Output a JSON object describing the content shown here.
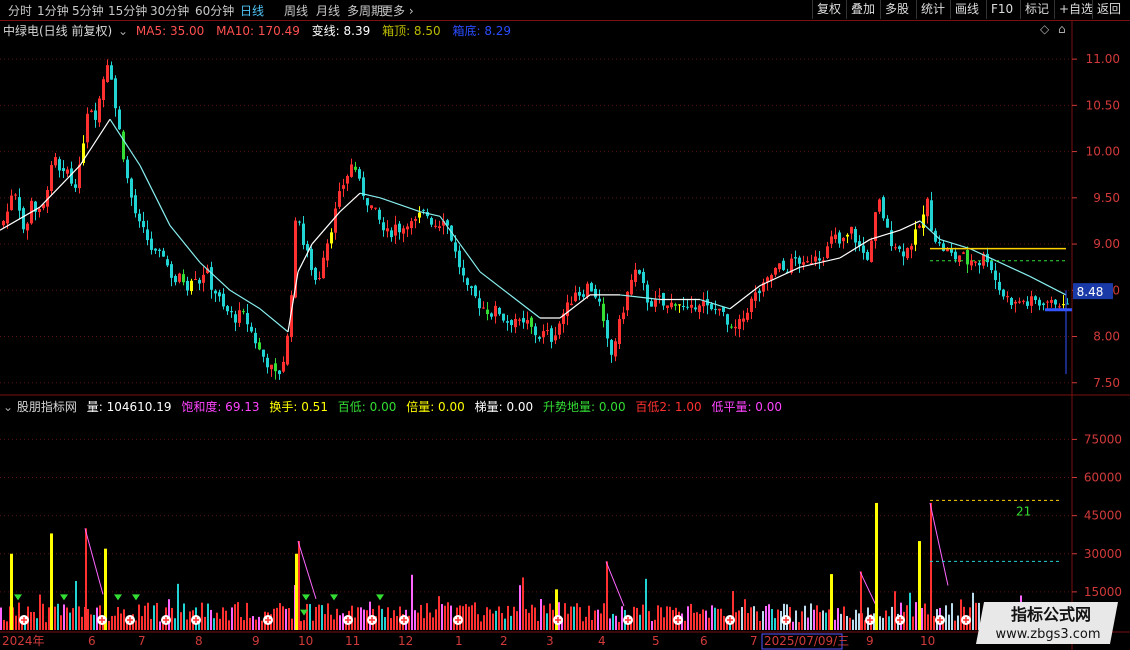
{
  "toolbar": {
    "timeframes": [
      "分时",
      "1分钟",
      "5分钟",
      "15分钟",
      "30分钟",
      "60分钟",
      "日线",
      "周线",
      "月线",
      "多周期",
      "更多"
    ],
    "active_timeframe": "日线",
    "buttons": [
      "复权",
      "叠加",
      "多股",
      "统计",
      "画线",
      "F10",
      "标记",
      "+自选",
      "返回"
    ]
  },
  "main": {
    "title": "中绿电(日线 前复权)",
    "ma5": "MA5: 35.00",
    "ma10": "MA10: 170.49",
    "var_line": "变线: 8.39",
    "box_top": "箱顶: 8.50",
    "box_bottom": "箱底: 8.29",
    "price_tag": "8.48"
  },
  "sub": {
    "title": "股朋指标网",
    "volume": "量: 104610.19",
    "saturation": "饱和度: 69.13",
    "turnover": "换手: 0.51",
    "hundred_low": "百低: 0.00",
    "multiple": "倍量: 0.00",
    "ladder": "梯量: 0.00",
    "rise_ground": "升势地量: 0.00",
    "hundred_low2": "百低2: 1.00",
    "low_flat": "低平量: 0.00",
    "marker_21": "21"
  },
  "colors": {
    "up": "#ff3030",
    "down": "#22d3d3",
    "yellow": "#ffff00",
    "green": "#33dd33",
    "magenta": "#ff44ff",
    "axis": "#d23a3a",
    "white": "#ffffff"
  },
  "chart_data": [
    {
      "type": "candlestick",
      "title": "中绿电(日线 前复权)",
      "y_ticks": [
        11.0,
        10.5,
        10.0,
        9.5,
        9.0,
        8.5,
        8.0,
        7.5
      ],
      "ylim": [
        7.4,
        11.25
      ],
      "x_ticks": [
        "2024年",
        "6",
        "7",
        "8",
        "9",
        "10",
        "11",
        "12",
        "1",
        "2",
        "3",
        "4",
        "5",
        "6",
        "7",
        "2025/07/09/三",
        "9",
        "10"
      ],
      "price_path": [
        [
          0,
          9.2
        ],
        [
          6,
          9.35
        ],
        [
          12,
          9.65
        ],
        [
          18,
          9.4
        ],
        [
          24,
          9.05
        ],
        [
          30,
          9.5
        ],
        [
          36,
          9.3
        ],
        [
          42,
          9.4
        ],
        [
          48,
          9.75
        ],
        [
          54,
          9.9
        ],
        [
          60,
          9.7
        ],
        [
          66,
          9.8
        ],
        [
          72,
          9.6
        ],
        [
          78,
          9.8
        ],
        [
          84,
          10.3
        ],
        [
          88,
          10.6
        ],
        [
          92,
          10.35
        ],
        [
          96,
          10.45
        ],
        [
          100,
          10.7
        ],
        [
          104,
          10.9
        ],
        [
          108,
          11.05
        ],
        [
          112,
          10.6
        ],
        [
          116,
          10.35
        ],
        [
          120,
          10.1
        ],
        [
          126,
          9.7
        ],
        [
          132,
          9.4
        ],
        [
          138,
          9.2
        ],
        [
          144,
          9.1
        ],
        [
          150,
          8.95
        ],
        [
          156,
          8.85
        ],
        [
          162,
          8.9
        ],
        [
          168,
          8.7
        ],
        [
          174,
          8.6
        ],
        [
          180,
          8.65
        ],
        [
          186,
          8.55
        ],
        [
          192,
          8.7
        ],
        [
          198,
          8.6
        ],
        [
          204,
          8.75
        ],
        [
          210,
          8.55
        ],
        [
          216,
          8.45
        ],
        [
          222,
          8.3
        ],
        [
          228,
          8.25
        ],
        [
          234,
          8.2
        ],
        [
          240,
          8.25
        ],
        [
          246,
          8.15
        ],
        [
          252,
          8.0
        ],
        [
          258,
          7.85
        ],
        [
          264,
          7.75
        ],
        [
          270,
          7.65
        ],
        [
          276,
          7.55
        ],
        [
          282,
          7.75
        ],
        [
          288,
          8.1
        ],
        [
          292,
          8.9
        ],
        [
          296,
          9.5
        ],
        [
          300,
          9.05
        ],
        [
          304,
          8.95
        ],
        [
          310,
          8.75
        ],
        [
          316,
          8.55
        ],
        [
          322,
          8.9
        ],
        [
          328,
          9.1
        ],
        [
          334,
          9.35
        ],
        [
          340,
          9.6
        ],
        [
          346,
          9.75
        ],
        [
          352,
          9.9
        ],
        [
          358,
          9.65
        ],
        [
          364,
          9.5
        ],
        [
          370,
          9.4
        ],
        [
          376,
          9.3
        ],
        [
          382,
          9.15
        ],
        [
          388,
          9.1
        ],
        [
          394,
          9.2
        ],
        [
          400,
          9.15
        ],
        [
          406,
          9.25
        ],
        [
          412,
          9.2
        ],
        [
          418,
          9.3
        ],
        [
          424,
          9.35
        ],
        [
          430,
          9.25
        ],
        [
          436,
          9.2
        ],
        [
          442,
          9.3
        ],
        [
          448,
          9.15
        ],
        [
          454,
          8.9
        ],
        [
          460,
          8.7
        ],
        [
          466,
          8.5
        ],
        [
          472,
          8.45
        ],
        [
          478,
          8.35
        ],
        [
          484,
          8.3
        ],
        [
          490,
          8.25
        ],
        [
          496,
          8.3
        ],
        [
          502,
          8.2
        ],
        [
          508,
          8.15
        ],
        [
          514,
          8.2
        ],
        [
          520,
          8.1
        ],
        [
          526,
          8.15
        ],
        [
          532,
          8.05
        ],
        [
          538,
          8.0
        ],
        [
          544,
          8.05
        ],
        [
          550,
          7.98
        ],
        [
          556,
          8.1
        ],
        [
          562,
          8.25
        ],
        [
          568,
          8.35
        ],
        [
          574,
          8.5
        ],
        [
          580,
          8.45
        ],
        [
          586,
          8.55
        ],
        [
          592,
          8.5
        ],
        [
          598,
          8.35
        ],
        [
          604,
          8.0
        ],
        [
          610,
          7.8
        ],
        [
          616,
          8.05
        ],
        [
          622,
          8.3
        ],
        [
          628,
          8.55
        ],
        [
          634,
          8.7
        ],
        [
          640,
          8.6
        ],
        [
          646,
          8.4
        ],
        [
          652,
          8.35
        ],
        [
          658,
          8.4
        ],
        [
          664,
          8.3
        ],
        [
          670,
          8.35
        ],
        [
          676,
          8.4
        ],
        [
          682,
          8.3
        ],
        [
          688,
          8.25
        ],
        [
          694,
          8.35
        ],
        [
          700,
          8.4
        ],
        [
          706,
          8.3
        ],
        [
          712,
          8.25
        ],
        [
          718,
          8.35
        ],
        [
          724,
          8.15
        ],
        [
          730,
          8.05
        ],
        [
          736,
          8.1
        ],
        [
          742,
          8.2
        ],
        [
          748,
          8.35
        ],
        [
          754,
          8.45
        ],
        [
          760,
          8.5
        ],
        [
          766,
          8.6
        ],
        [
          772,
          8.7
        ],
        [
          778,
          8.75
        ],
        [
          784,
          8.7
        ],
        [
          790,
          8.8
        ],
        [
          796,
          8.85
        ],
        [
          802,
          8.75
        ],
        [
          808,
          8.8
        ],
        [
          814,
          8.9
        ],
        [
          820,
          8.85
        ],
        [
          826,
          8.95
        ],
        [
          832,
          9.1
        ],
        [
          838,
          9.0
        ],
        [
          844,
          9.05
        ],
        [
          850,
          9.15
        ],
        [
          856,
          9.0
        ],
        [
          862,
          8.9
        ],
        [
          868,
          8.85
        ],
        [
          874,
          9.3
        ],
        [
          878,
          9.45
        ],
        [
          882,
          9.3
        ],
        [
          888,
          9.05
        ],
        [
          894,
          9.0
        ],
        [
          900,
          8.9
        ],
        [
          906,
          8.95
        ],
        [
          912,
          9.05
        ],
        [
          918,
          9.2
        ],
        [
          922,
          9.3
        ],
        [
          926,
          9.45
        ],
        [
          930,
          9.2
        ],
        [
          936,
          9.0
        ],
        [
          942,
          8.95
        ],
        [
          948,
          8.9
        ],
        [
          954,
          8.85
        ],
        [
          960,
          8.9
        ],
        [
          966,
          8.8
        ],
        [
          972,
          8.85
        ],
        [
          978,
          8.8
        ],
        [
          984,
          8.9
        ],
        [
          990,
          8.75
        ],
        [
          996,
          8.55
        ],
        [
          1002,
          8.45
        ],
        [
          1008,
          8.4
        ],
        [
          1014,
          8.35
        ],
        [
          1020,
          8.4
        ],
        [
          1026,
          8.35
        ],
        [
          1032,
          8.4
        ],
        [
          1038,
          8.35
        ],
        [
          1044,
          8.4
        ],
        [
          1050,
          8.35
        ],
        [
          1056,
          8.4
        ],
        [
          1062,
          8.3
        ],
        [
          1066,
          8.39
        ]
      ],
      "ma_line": [
        [
          0,
          9.15
        ],
        [
          40,
          9.4
        ],
        [
          80,
          9.85
        ],
        [
          110,
          10.35
        ],
        [
          140,
          9.85
        ],
        [
          170,
          9.2
        ],
        [
          200,
          8.8
        ],
        [
          230,
          8.5
        ],
        [
          260,
          8.3
        ],
        [
          288,
          8.05
        ],
        [
          298,
          8.7
        ],
        [
          312,
          9.0
        ],
        [
          340,
          9.35
        ],
        [
          360,
          9.55
        ],
        [
          380,
          9.5
        ],
        [
          420,
          9.35
        ],
        [
          440,
          9.3
        ],
        [
          460,
          9.0
        ],
        [
          480,
          8.7
        ],
        [
          510,
          8.45
        ],
        [
          540,
          8.2
        ],
        [
          560,
          8.2
        ],
        [
          590,
          8.45
        ],
        [
          620,
          8.45
        ],
        [
          660,
          8.4
        ],
        [
          700,
          8.4
        ],
        [
          730,
          8.3
        ],
        [
          760,
          8.55
        ],
        [
          800,
          8.75
        ],
        [
          840,
          8.85
        ],
        [
          870,
          9.05
        ],
        [
          900,
          9.15
        ],
        [
          920,
          9.25
        ],
        [
          940,
          9.05
        ],
        [
          970,
          8.95
        ],
        [
          1000,
          8.8
        ],
        [
          1030,
          8.65
        ],
        [
          1066,
          8.45
        ]
      ],
      "box_top_line": 8.95,
      "box_mid_line": 8.82,
      "box_bottom_line": 8.29
    },
    {
      "type": "bar",
      "title": "股朋指标网",
      "y_ticks": [
        75000,
        60000,
        45000,
        30000,
        15000
      ],
      "ylim": [
        0,
        85000
      ],
      "highlights": [
        {
          "x": 10,
          "v": 30000,
          "c": "yellow"
        },
        {
          "x": 50,
          "v": 38000,
          "c": "yellow"
        },
        {
          "x": 104,
          "v": 32000,
          "c": "yellow"
        },
        {
          "x": 295,
          "v": 30000,
          "c": "yellow"
        },
        {
          "x": 555,
          "v": 16000,
          "c": "yellow"
        },
        {
          "x": 830,
          "v": 22000,
          "c": "yellow"
        },
        {
          "x": 875,
          "v": 50000,
          "c": "yellow"
        },
        {
          "x": 918,
          "v": 35000,
          "c": "yellow"
        },
        {
          "x": 1000,
          "v": 10000,
          "c": "yellow"
        }
      ],
      "spikes": [
        {
          "x": 85,
          "v": 40000
        },
        {
          "x": 298,
          "v": 35000
        },
        {
          "x": 606,
          "v": 27000
        },
        {
          "x": 930,
          "v": 50000
        },
        {
          "x": 860,
          "v": 23000
        }
      ]
    }
  ]
}
